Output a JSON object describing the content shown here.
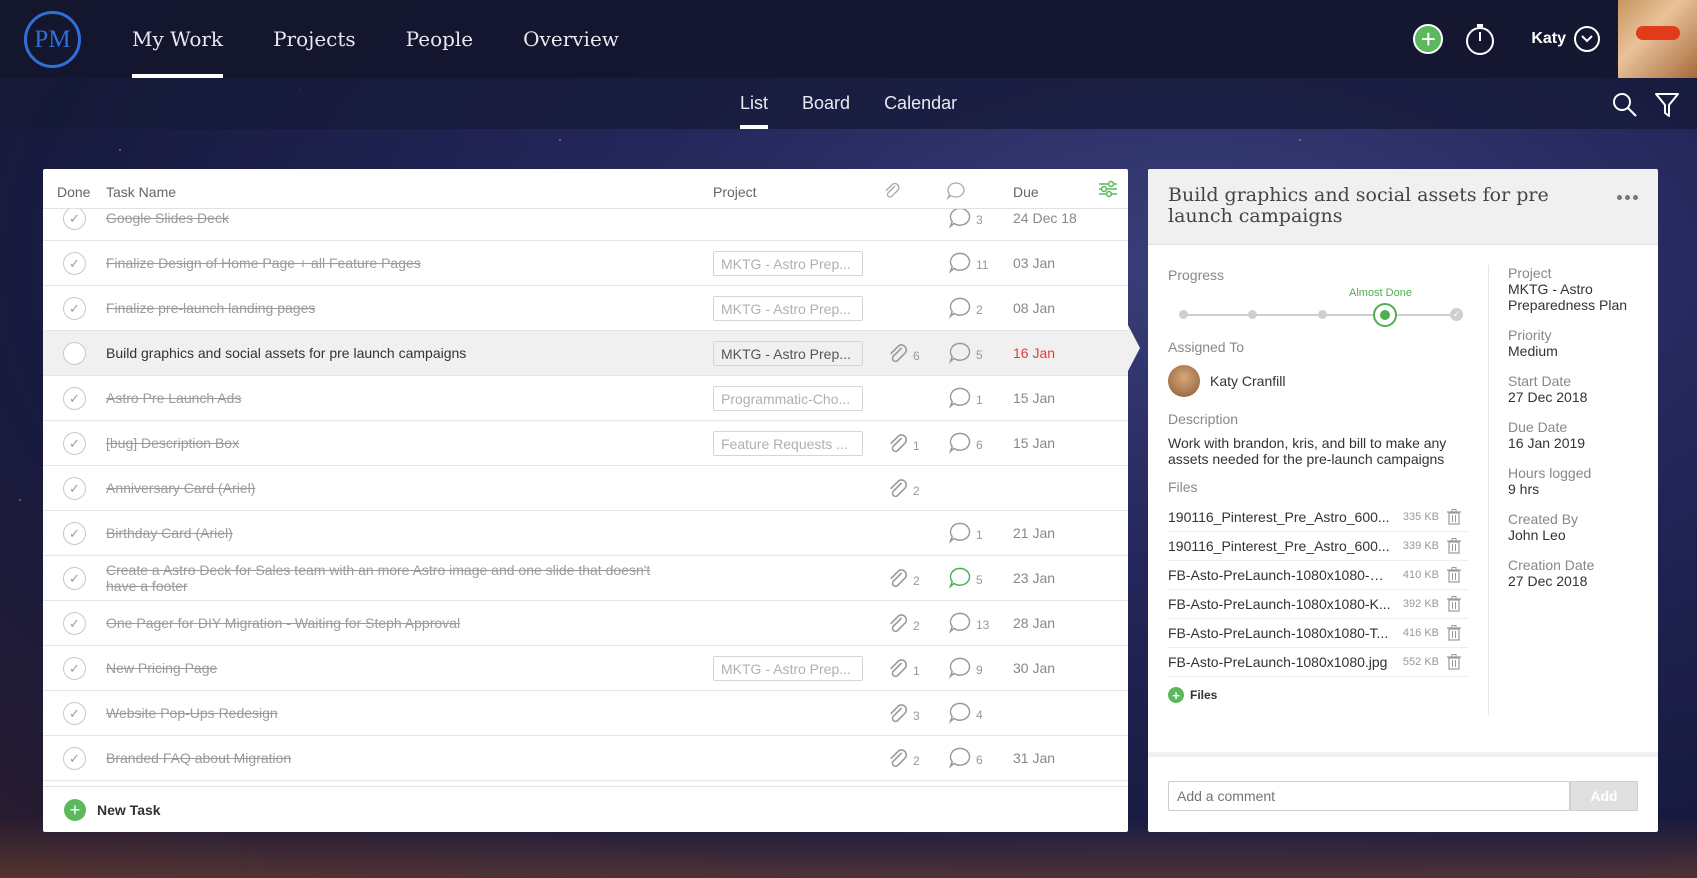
{
  "app": {
    "logo_text": "PM"
  },
  "topnav": {
    "items": [
      {
        "label": "My Work",
        "active": true
      },
      {
        "label": "Projects",
        "active": false
      },
      {
        "label": "People",
        "active": false
      },
      {
        "label": "Overview",
        "active": false
      }
    ],
    "user_name": "Katy",
    "icons": [
      "plus-circle-icon",
      "stopwatch-icon",
      "chevron-down-icon"
    ]
  },
  "subnav": {
    "items": [
      {
        "label": "List",
        "active": true
      },
      {
        "label": "Board",
        "active": false
      },
      {
        "label": "Calendar",
        "active": false
      }
    ],
    "icons": [
      "search-icon",
      "filter-icon"
    ]
  },
  "task_list": {
    "columns": {
      "done": "Done",
      "task_name": "Task Name",
      "project": "Project",
      "due": "Due"
    },
    "rows": [
      {
        "name": "Google Slides Deck",
        "project": "",
        "attachments": "",
        "comments": "3",
        "due": "24 Dec 18",
        "done": true
      },
      {
        "name": "Finalize Design of Home Page + all Feature Pages",
        "project": "MKTG - Astro Prep...",
        "attachments": "",
        "comments": "11",
        "due": "03 Jan",
        "done": true
      },
      {
        "name": "Finalize pre-launch landing pages",
        "project": "MKTG - Astro Prep...",
        "attachments": "",
        "comments": "2",
        "due": "08 Jan",
        "done": true
      },
      {
        "name": "Build graphics and social assets for pre launch campaigns",
        "project": "MKTG - Astro Prep...",
        "attachments": "6",
        "comments": "5",
        "due": "16 Jan",
        "done": false,
        "selected": true,
        "overdue": true
      },
      {
        "name": "Astro Pre Launch Ads",
        "project": "Programmatic-Cho...",
        "attachments": "",
        "comments": "1",
        "due": "15 Jan",
        "done": true
      },
      {
        "name": "[bug] Description Box",
        "project": "Feature Requests ...",
        "attachments": "1",
        "comments": "6",
        "due": "15 Jan",
        "done": true
      },
      {
        "name": "Anniversary Card (Ariel)",
        "project": "",
        "attachments": "2",
        "comments": "",
        "due": "",
        "done": true
      },
      {
        "name": "Birthday Card (Ariel)",
        "project": "",
        "attachments": "",
        "comments": "1",
        "due": "21 Jan",
        "done": true
      },
      {
        "name": "Create a Astro Deck for Sales team with an more Astro image and one slide that doesn't have a footer",
        "project": "",
        "attachments": "2",
        "comments": "5",
        "comments_active": true,
        "due": "23 Jan",
        "done": true
      },
      {
        "name": "One Pager for DIY Migration - Waiting for Steph Approval",
        "project": "",
        "attachments": "2",
        "comments": "13",
        "due": "28 Jan",
        "done": true
      },
      {
        "name": "New Pricing Page",
        "project": "MKTG - Astro Prep...",
        "attachments": "1",
        "comments": "9",
        "due": "30 Jan",
        "done": true
      },
      {
        "name": "Website Pop-Ups Redesign",
        "project": "",
        "attachments": "3",
        "comments": "4",
        "due": "",
        "done": true
      },
      {
        "name": "Branded FAQ about Migration",
        "project": "",
        "attachments": "2",
        "comments": "6",
        "due": "31 Jan",
        "done": true
      }
    ],
    "new_task_label": "New Task"
  },
  "detail": {
    "title": "Build graphics and social assets for pre launch campaigns",
    "progress_label": "Progress",
    "progress_status": "Almost Done",
    "progress_step": 4,
    "progress_steps_total": 5,
    "assigned_label": "Assigned To",
    "assignee": "Katy Cranfill",
    "description_label": "Description",
    "description": "Work with brandon, kris, and bill to make any assets needed for the pre-launch campaigns",
    "files_label": "Files",
    "files": [
      {
        "name": "190116_Pinterest_Pre_Astro_600...",
        "size": "335 KB"
      },
      {
        "name": "190116_Pinterest_Pre_Astro_600...",
        "size": "339 KB"
      },
      {
        "name": "FB-Asto-PreLaunch-1080x1080-G...",
        "size": "410 KB"
      },
      {
        "name": "FB-Asto-PreLaunch-1080x1080-K...",
        "size": "392 KB"
      },
      {
        "name": "FB-Asto-PreLaunch-1080x1080-T...",
        "size": "416 KB"
      },
      {
        "name": "FB-Asto-PreLaunch-1080x1080.jpg",
        "size": "552 KB"
      }
    ],
    "add_files_label": "Files",
    "meta": [
      {
        "label": "Project",
        "value": "MKTG - Astro Preparedness Plan"
      },
      {
        "label": "Priority",
        "value": "Medium"
      },
      {
        "label": "Start Date",
        "value": "27 Dec 2018"
      },
      {
        "label": "Due Date",
        "value": "16 Jan 2019"
      },
      {
        "label": "Hours logged",
        "value": "9 hrs"
      },
      {
        "label": "Created By",
        "value": "John Leo"
      },
      {
        "label": "Creation Date",
        "value": "27 Dec 2018"
      }
    ],
    "comment_placeholder": "Add a comment",
    "comment_button": "Add"
  },
  "colors": {
    "accent_green": "#5cb85c",
    "overdue_red": "#e53b3b",
    "logo_blue": "#2f6fd6"
  }
}
